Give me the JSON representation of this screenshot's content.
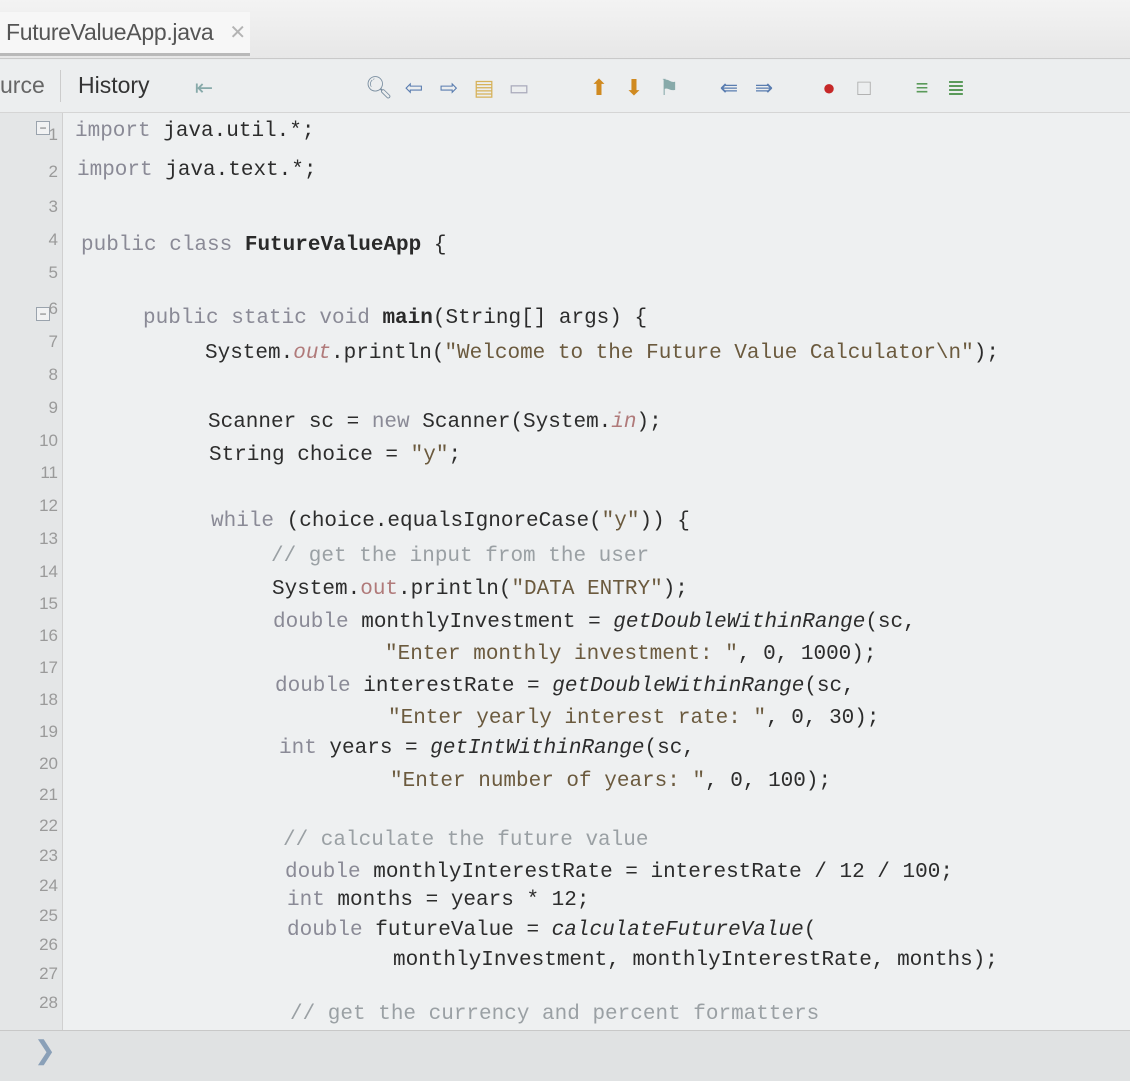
{
  "tab": {
    "title": "FutureValueApp.java",
    "close": "✕"
  },
  "toolbar": {
    "source_label": "urce",
    "history_label": "History"
  },
  "gutter": {
    "line_numbers": [
      "1",
      "2",
      "3",
      "4",
      "5",
      "6",
      "7",
      "8",
      "9",
      "10",
      "11",
      "12",
      "13",
      "14",
      "15",
      "16",
      "17",
      "18",
      "19",
      "20",
      "21",
      "22",
      "23",
      "24",
      "25",
      "26",
      "27",
      "28"
    ]
  },
  "code": {
    "l1_kw": "import",
    "l1_rest": " java.util.*;",
    "l2_kw": "import",
    "l2_rest": " java.text.*;",
    "l4_kw": "public class",
    "l4_name": " FutureValueApp",
    "l4_rest": " {",
    "l6_kw": "public static void",
    "l6_name": " main",
    "l6_rest": "(String[] args) {",
    "l7_a": "System.",
    "l7_field": "out",
    "l7_b": ".println(",
    "l7_str": "\"Welcome to the Future Value Calculator\\n\"",
    "l7_end": ");",
    "l9_a": "Scanner sc = ",
    "l9_kw": "new",
    "l9_b": " Scanner(System.",
    "l9_field": "in",
    "l9_end": ");",
    "l10_a": "String choice = ",
    "l10_str": "\"y\"",
    "l10_end": ";",
    "l12_kw": "while",
    "l12_rest": " (choice.equalsIgnoreCase(",
    "l12_str": "\"y\"",
    "l12_end": ")) {",
    "l13_cmt": "// get the input from the user",
    "l14_a": "System.",
    "l14_field": "out",
    "l14_b": ".println(",
    "l14_str": "\"DATA ENTRY\"",
    "l14_end": ");",
    "l15_kw": "double",
    "l15_a": " monthlyInvestment = ",
    "l15_fn": "getDoubleWithinRange",
    "l15_end": "(sc,",
    "l16_str": "\"Enter monthly investment: \"",
    "l16_end": ", 0, 1000);",
    "l17_kw": "double",
    "l17_a": " interestRate = ",
    "l17_fn": "getDoubleWithinRange",
    "l17_end": "(sc,",
    "l18_str": "\"Enter yearly interest rate: \"",
    "l18_end": ", 0, 30);",
    "l19_kw": "int",
    "l19_a": " years = ",
    "l19_fn": "getIntWithinRange",
    "l19_end": "(sc,",
    "l20_str": "\"Enter number of years: \"",
    "l20_end": ", 0, 100);",
    "l22_cmt": "// calculate the future value",
    "l23_kw": "double",
    "l23_rest": " monthlyInterestRate = interestRate / 12 / 100;",
    "l24_kw": "int",
    "l24_rest": " months = years * 12;",
    "l25_kw": "double",
    "l25_a": " futureValue = ",
    "l25_fn": "calculateFutureValue",
    "l25_end": "(",
    "l26_rest": "monthlyInvestment, monthlyInterestRate, months);",
    "l28_cmt": "// get the currency and percent formatters"
  },
  "status": {
    "chevron": "❯"
  }
}
